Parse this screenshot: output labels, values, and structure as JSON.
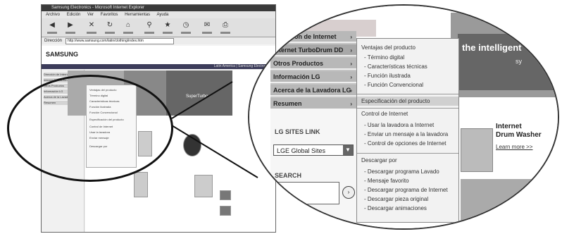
{
  "browser": {
    "title": "Samsung Electronics - Microsoft Internet Explorer",
    "menu": [
      "Archivo",
      "Edición",
      "Ver",
      "Favoritos",
      "Herramientas",
      "Ayuda"
    ],
    "toolbar": [
      "Atrás",
      "Adelante",
      "Detener",
      "Actualizar",
      "Inicio",
      "Búsqueda",
      "Favoritos",
      "Historial",
      "Correo",
      "Imprimir"
    ],
    "address_label": "Dirección",
    "address_value": "http://www.samsung.com/latin/clothing/index.htm",
    "logo": "SAMSUNG",
    "blue_bar_text": "Latin America | Samsung Electronics",
    "left_nav": [
      "Dirección de Internet",
      "Internet TurboDrum DD",
      "Otros Productos",
      "Información LG",
      "Acerca de la Lavadora",
      "Resumen"
    ],
    "mini_dropdown": [
      "Ventajas del producto",
      "Término digital",
      "Características técnicas",
      "Función ilustrada",
      "Función Convencional",
      "Especificación del producto",
      "Control de Internet",
      "Usar la lavadora",
      "Enviar mensaje",
      "Descargar por"
    ],
    "banner_tag": "SuperTurbo"
  },
  "magnified": {
    "main_menu": [
      {
        "label": "Dirección de Internet",
        "arrow": "›"
      },
      {
        "label": "Internet TurboDrum DD",
        "arrow": "›"
      },
      {
        "label": "Otros Productos",
        "arrow": "›"
      },
      {
        "label": "Información LG",
        "arrow": "›"
      },
      {
        "label": "Acerca de la Lavadora LG",
        "arrow": "›"
      },
      {
        "label": "Resumen",
        "arrow": "›"
      }
    ],
    "submenu": {
      "sec1_title": "Ventajas del producto",
      "sec1_items": [
        "- Término digital",
        "- Características técnicas",
        "- Función ilustrada",
        "- Función Convencional"
      ],
      "sec2_title": "Especificación del producto",
      "sec3_title": "Control de Internet",
      "sec3_items": [
        "- Usar la lavadora a Internet",
        "- Enviar un mensaje a la lavadora",
        "- Control de opciones de Internet"
      ],
      "sec4_title": "Descargar por",
      "sec4_items": [
        "- Descargar programa Lavado",
        "- Mensaje favorito",
        "- Descargar programa de Internet",
        "- Descargar pieza original",
        "- Descargar animaciones"
      ]
    },
    "left_col": {
      "sites_label": "LG SITES LINK",
      "site_select_value": "LGE Global Sites",
      "search_label": "SEARCH"
    },
    "right_banner_text": "the intelligent",
    "right_banner_sub": "sy",
    "product": {
      "title_line1": "Internet",
      "title_line2": "Drum Washer",
      "link": "Learn more >>"
    }
  }
}
